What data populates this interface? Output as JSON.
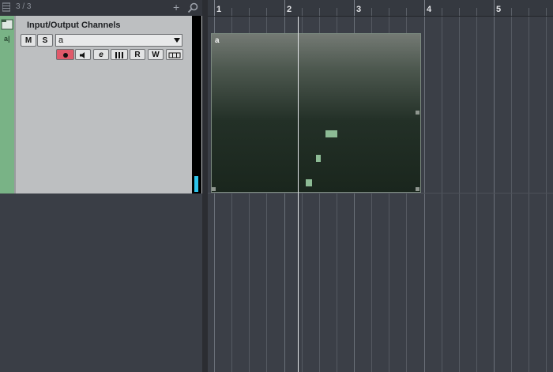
{
  "header": {
    "track_count": "3 / 3",
    "add_label": "+"
  },
  "track": {
    "name": "Input/Output Channels",
    "name_field_value": "a",
    "strip_mark": "a|",
    "m_label": "M",
    "s_label": "S",
    "edit_label": "e",
    "read_label": "R",
    "write_label": "W",
    "meter_level": 0.09
  },
  "ruler": {
    "bars": [
      "1",
      "2",
      "3",
      "4",
      "5"
    ]
  },
  "part": {
    "name": "a"
  },
  "colors": {
    "record": "#e0596a",
    "meter": "#2ec4ec",
    "folder": "#79b386",
    "note": "#8dbb95"
  },
  "icons": [
    "list-icon",
    "add-icon",
    "search-icon",
    "folder-icon",
    "dropdown-arrow-icon",
    "record-icon",
    "monitor-icon",
    "edit-icon",
    "piano-icon",
    "lanes-icon"
  ]
}
